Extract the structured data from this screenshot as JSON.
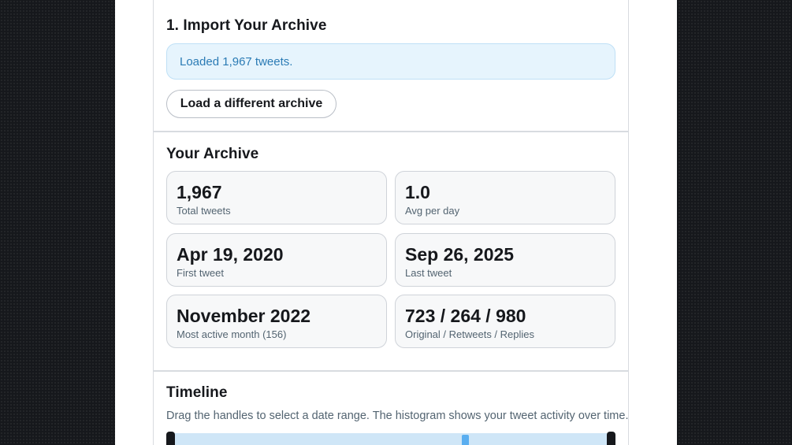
{
  "import": {
    "title": "1. Import Your Archive",
    "status_text": "Loaded 1,967 tweets.",
    "load_button_label": "Load a different archive"
  },
  "archive": {
    "title": "Your Archive",
    "stats": [
      {
        "value": "1,967",
        "label": "Total tweets"
      },
      {
        "value": "1.0",
        "label": "Avg per day"
      },
      {
        "value": "Apr 19, 2020",
        "label": "First tweet"
      },
      {
        "value": "Sep 26, 2025",
        "label": "Last tweet"
      },
      {
        "value": "November 2022",
        "label": "Most active month (156)"
      },
      {
        "value": "723 / 264 / 980",
        "label": "Original / Retweets / Replies"
      }
    ]
  },
  "timeline": {
    "title": "Timeline",
    "description": "Drag the handles to select a date range. The histogram shows your tweet activity over time."
  },
  "colors": {
    "status_background": "#e6f4fd",
    "status_text": "#2b7bb5",
    "histogram_bar": "#5aaef0",
    "slider_track": "#cfe6f7",
    "handle": "#16181c"
  }
}
